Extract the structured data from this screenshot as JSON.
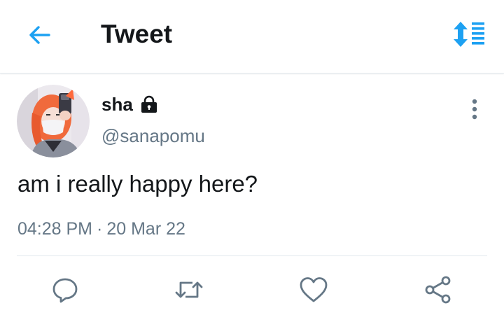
{
  "header": {
    "title": "Tweet",
    "back_icon": "arrow-left-icon",
    "sort_icon": "sort-order-icon"
  },
  "tweet": {
    "display_name": "sha",
    "protected_icon": "lock-icon",
    "handle": "@sanapomu",
    "text": "am i really happy here?",
    "time": "04:28 PM",
    "separator": "·",
    "date": "20 Mar 22"
  },
  "actions": {
    "reply_icon": "reply-icon",
    "retweet_icon": "retweet-icon",
    "like_icon": "like-icon",
    "share_icon": "share-icon"
  },
  "colors": {
    "accent": "#1da1f2",
    "text": "#14171a",
    "secondary": "#657786",
    "divider": "#e1e8ed"
  }
}
